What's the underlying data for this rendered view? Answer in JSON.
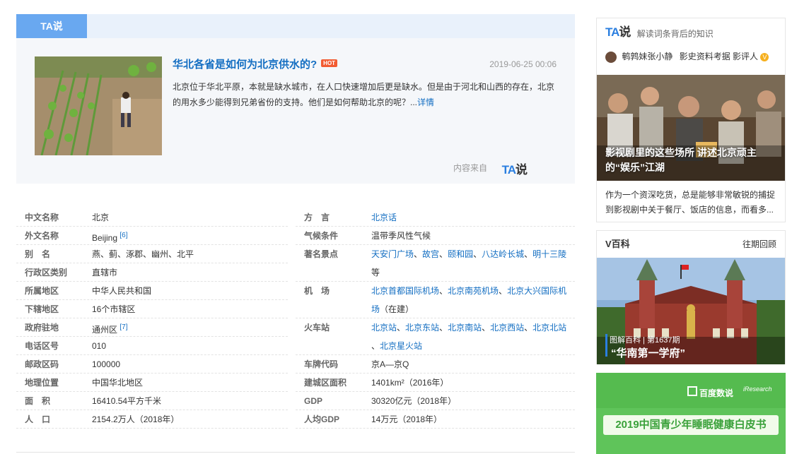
{
  "ta_module": {
    "tab_label": "TA说",
    "title": "华北各省是如何为北京供水的?",
    "hot_badge": "HOT",
    "date": "2019-06-25 00:06",
    "desc": "北京位于华北平原，本就是缺水城市，在人口快速增加后更是缺水。但是由于河北和山西的存在，北京的用水多少能得到兄弟省份的支持。他们是如何帮助北京的呢？...",
    "detail_link": "详情",
    "source_label": "内容来自",
    "source_logo_t": "TA",
    "source_logo_s": "说"
  },
  "info_left": [
    {
      "k": "中文名称",
      "v": "北京"
    },
    {
      "k": "外文名称",
      "v": "Beijing",
      "sup": "[6]"
    },
    {
      "k": "别　名",
      "v": "燕、蓟、涿郡、幽州、北平"
    },
    {
      "k": "行政区类别",
      "v": "直辖市"
    },
    {
      "k": "所属地区",
      "v": "中华人民共和国"
    },
    {
      "k": "下辖地区",
      "v": "16个市辖区"
    },
    {
      "k": "政府驻地",
      "v": "通州区",
      "sup": "[7]"
    },
    {
      "k": "电话区号",
      "v": "010"
    },
    {
      "k": "邮政区码",
      "v": "100000"
    },
    {
      "k": "地理位置",
      "v": "中国华北地区"
    },
    {
      "k": "面　积",
      "v": "16410.54平方千米"
    },
    {
      "k": "人　口",
      "v": "2154.2万人（2018年）"
    }
  ],
  "info_right": {
    "dialect": {
      "k": "方　言",
      "v": "北京话"
    },
    "climate": {
      "k": "气候条件",
      "v": "温带季风性气候"
    },
    "attractions": {
      "k": "著名景点",
      "links": [
        "天安门广场",
        "故宫",
        "颐和园",
        "八达岭长城",
        "明十三陵"
      ],
      "line2": "等"
    },
    "airport": {
      "k": "机　场",
      "links": [
        "北京首都国际机场",
        "北京南苑机场",
        "北京大兴国际机"
      ],
      "line2_link": "场",
      "line2_text": "（在建）"
    },
    "station": {
      "k": "火车站",
      "links": [
        "北京站",
        "北京东站",
        "北京南站",
        "北京西站",
        "北京北站"
      ],
      "line2_link": "北京星火站"
    },
    "plate": {
      "k": "车牌代码",
      "v": "京A—京Q"
    },
    "urban_area": {
      "k": "建城区面积",
      "v": "1401km²（2016年）"
    },
    "gdp": {
      "k": "GDP",
      "v": "30320亿元（2018年）"
    },
    "gdp_per": {
      "k": "人均GDP",
      "v": "14万元（2018年）"
    }
  },
  "side_ta": {
    "logo_t": "TA",
    "logo_s": "说",
    "subtitle": "解读词条背后的知识",
    "author": "鹌鹑妹张小静",
    "author_desc": "影史资料考据 影评人",
    "author_badge": "V",
    "pic_title": "影视剧里的这些场所 讲述北京顽主的“娱乐”江湖",
    "desc": "作为一个资深吃货，总是能够非常敏锐的捕捉到影视剧中关于餐厅、饭店的信息，而看多..."
  },
  "side_v": {
    "title": "V百科",
    "more": "往期回顾",
    "caption_small": "图解百科 | 第1637期",
    "caption_big": "“华南第一学府”"
  },
  "side_ad": {
    "logo1": "百度数说",
    "logo2": "iResearch",
    "banner": "2019中国青少年睡眠健康白皮书"
  }
}
